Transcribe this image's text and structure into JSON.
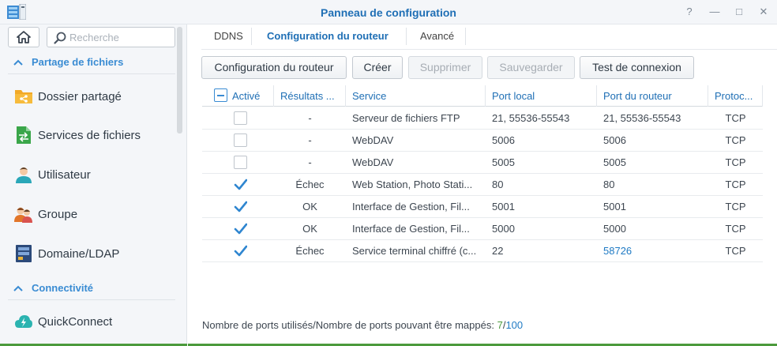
{
  "window": {
    "title": "Panneau de configuration",
    "controls": {
      "help": "?",
      "minimize": "—",
      "maximize": "□",
      "close": "✕"
    }
  },
  "sidebar": {
    "search_placeholder": "Recherche",
    "sections": [
      {
        "label": "Partage de fichiers"
      },
      {
        "label": "Connectivité"
      }
    ],
    "items": [
      {
        "label": "Dossier partagé",
        "icon": "folder-share-icon"
      },
      {
        "label": "Services de fichiers",
        "icon": "file-services-icon"
      },
      {
        "label": "Utilisateur",
        "icon": "user-icon"
      },
      {
        "label": "Groupe",
        "icon": "group-icon"
      },
      {
        "label": "Domaine/LDAP",
        "icon": "domain-icon"
      },
      {
        "label": "QuickConnect",
        "icon": "quickconnect-icon"
      }
    ]
  },
  "tabs": [
    {
      "label": "DDNS",
      "active": false
    },
    {
      "label": "Configuration du routeur",
      "active": true
    },
    {
      "label": "Avancé",
      "active": false
    }
  ],
  "toolbar": {
    "router_config": "Configuration du routeur",
    "create": "Créer",
    "delete": "Supprimer",
    "save": "Sauvegarder",
    "test": "Test de connexion"
  },
  "table": {
    "columns": [
      "Activé",
      "Résultats ...",
      "Service",
      "Port local",
      "Port du routeur",
      "Protoc..."
    ],
    "rows": [
      {
        "enabled": false,
        "result": "-",
        "service": "Serveur de fichiers FTP",
        "local_port": "21, 55536-55543",
        "router_port": "21, 55536-55543",
        "protocol": "TCP"
      },
      {
        "enabled": false,
        "result": "-",
        "service": "WebDAV",
        "local_port": "5006",
        "router_port": "5006",
        "protocol": "TCP"
      },
      {
        "enabled": false,
        "result": "-",
        "service": "WebDAV",
        "local_port": "5005",
        "router_port": "5005",
        "protocol": "TCP"
      },
      {
        "enabled": true,
        "result": "Échec",
        "service": "Web Station, Photo Stati...",
        "local_port": "80",
        "router_port": "80",
        "protocol": "TCP"
      },
      {
        "enabled": true,
        "result": "OK",
        "service": "Interface de Gestion, Fil...",
        "local_port": "5001",
        "router_port": "5001",
        "protocol": "TCP"
      },
      {
        "enabled": true,
        "result": "OK",
        "service": "Interface de Gestion, Fil...",
        "local_port": "5000",
        "router_port": "5000",
        "protocol": "TCP"
      },
      {
        "enabled": true,
        "result": "Échec",
        "service": "Service terminal chiffré (c...",
        "local_port": "22",
        "router_port": "58726",
        "protocol": "TCP"
      }
    ]
  },
  "footer": {
    "label": "Nombre de ports utilisés/Nombre de ports pouvant être mappés:",
    "used": "7",
    "separator": "/",
    "max": "100"
  },
  "colors": {
    "accent": "#1f6fb5",
    "check": "#2f86d0",
    "ok_green": "#4b9a3c"
  }
}
